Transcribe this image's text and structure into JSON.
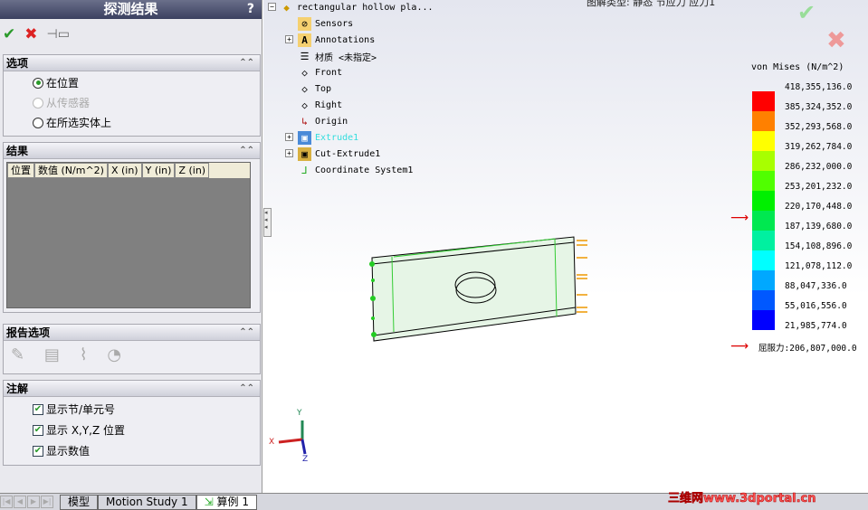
{
  "panel": {
    "title": "探测结果",
    "help": "?",
    "options": {
      "header": "选项",
      "items": [
        {
          "label": "在位置",
          "checked": true,
          "disabled": false
        },
        {
          "label": "从传感器",
          "checked": false,
          "disabled": true
        },
        {
          "label": "在所选实体上",
          "checked": false,
          "disabled": false
        }
      ]
    },
    "results": {
      "header": "结果",
      "columns": [
        "位置",
        "数值 (N/m^2)",
        "X (in)",
        "Y (in)",
        "Z (in)"
      ]
    },
    "report": {
      "header": "报告选项"
    },
    "annotations": {
      "header": "注解",
      "items": [
        "显示节/单元号",
        "显示 X,Y,Z 位置",
        "显示数值"
      ]
    }
  },
  "tabs": [
    "模型",
    "Motion Study 1",
    "算例 1"
  ],
  "tree": {
    "root": "rectangular hollow pla...",
    "items": [
      "Sensors",
      "Annotations",
      "材质 <未指定>",
      "Front",
      "Top",
      "Right",
      "Origin",
      "Extrude1",
      "Cut-Extrude1",
      "Coordinate System1"
    ]
  },
  "plot_type": "图解类型: 静态 节应力 应力1",
  "legend": {
    "title": "von Mises (N/m^2)",
    "labels": [
      "418,355,136.0",
      "385,324,352.0",
      "352,293,568.0",
      "319,262,784.0",
      "286,232,000.0",
      "253,201,232.0",
      "220,170,448.0",
      "187,139,680.0",
      "154,108,896.0",
      "121,078,112.0",
      "88,047,336.0",
      "55,016,556.0",
      "21,985,774.0"
    ],
    "colors": [
      "#ff0000",
      "#ff8000",
      "#ffff00",
      "#a8ff00",
      "#50ff00",
      "#00f000",
      "#00e850",
      "#00f0a0",
      "#00ffff",
      "#00a8ff",
      "#0058ff",
      "#0000ff"
    ],
    "yield": "屈服力:206,807,000.0"
  },
  "axes": {
    "x": "X",
    "y": "Y",
    "z": "Z"
  },
  "watermark": "三维网www.3dportal.cn"
}
